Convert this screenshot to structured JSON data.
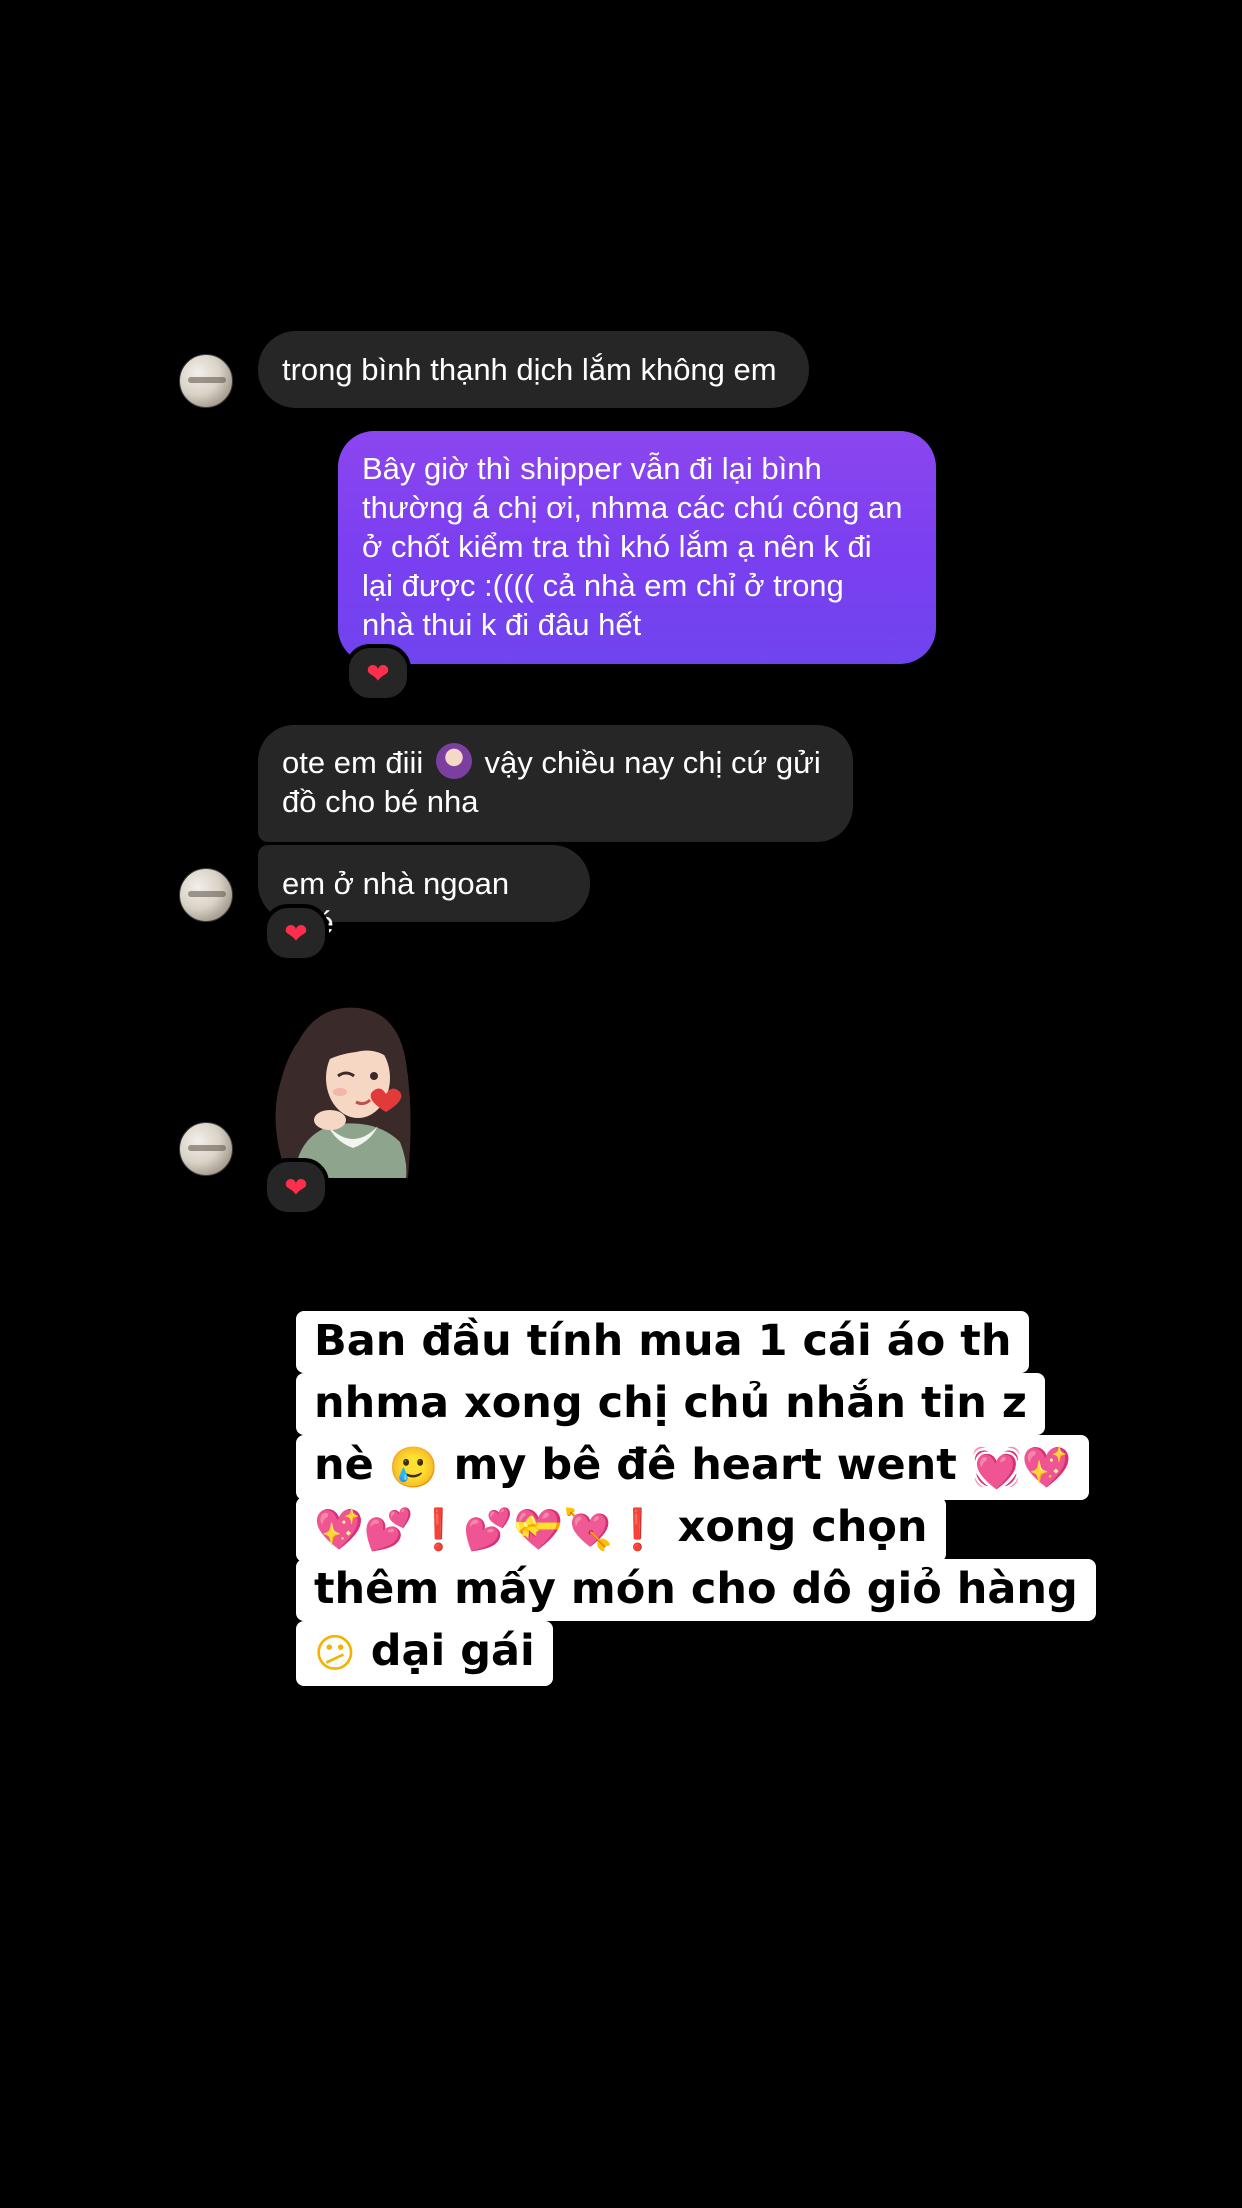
{
  "colors": {
    "background": "#000000",
    "incoming_bubble": "#262626",
    "outgoing_bubble": "#7a3ff0",
    "reaction_heart": "#ff2e4c",
    "caption_box": "#ffffff"
  },
  "messages": {
    "m1": "trong bình thạnh dịch lắm không em",
    "m2": [
      "Bây giờ thì shipper vẫn đi lại bình",
      "thường á chị ơi, nhma các chú công an",
      "ở chốt kiểm tra thì khó lắm ạ nên k đi",
      "lại được :(((( cả nhà em chỉ ở trong",
      "nhà thui k đi đâu hết"
    ],
    "m3_a": "ote em điii",
    "m3_b": "vậy chiều nay chị cứ gửi",
    "m3_c": "đồ cho bé nha",
    "m4": "em ở nhà ngoan nhé"
  },
  "reactions": {
    "heart": "❤"
  },
  "icons": {
    "avatar": "avatar-image",
    "inline_emoji": "woman-emoji-icon",
    "sticker": "girl-wink-sticker"
  },
  "caption": {
    "line1": "Ban đầu tính mua 1 cái áo th",
    "line2": "nhma xong chị chủ nhắn tin z",
    "line3_text": "nè",
    "line3_emoji": "🥲",
    "line3_tail": "my bê đê heart went",
    "line3_hearts": "💓💖",
    "line4_emojis": "💖💕❗💕💝💘❗",
    "line4_tail": "xong chọn",
    "line5": "thêm mấy món cho dô giỏ hàng",
    "line6_emoji": "😕",
    "line6_tail": "dại gái"
  }
}
